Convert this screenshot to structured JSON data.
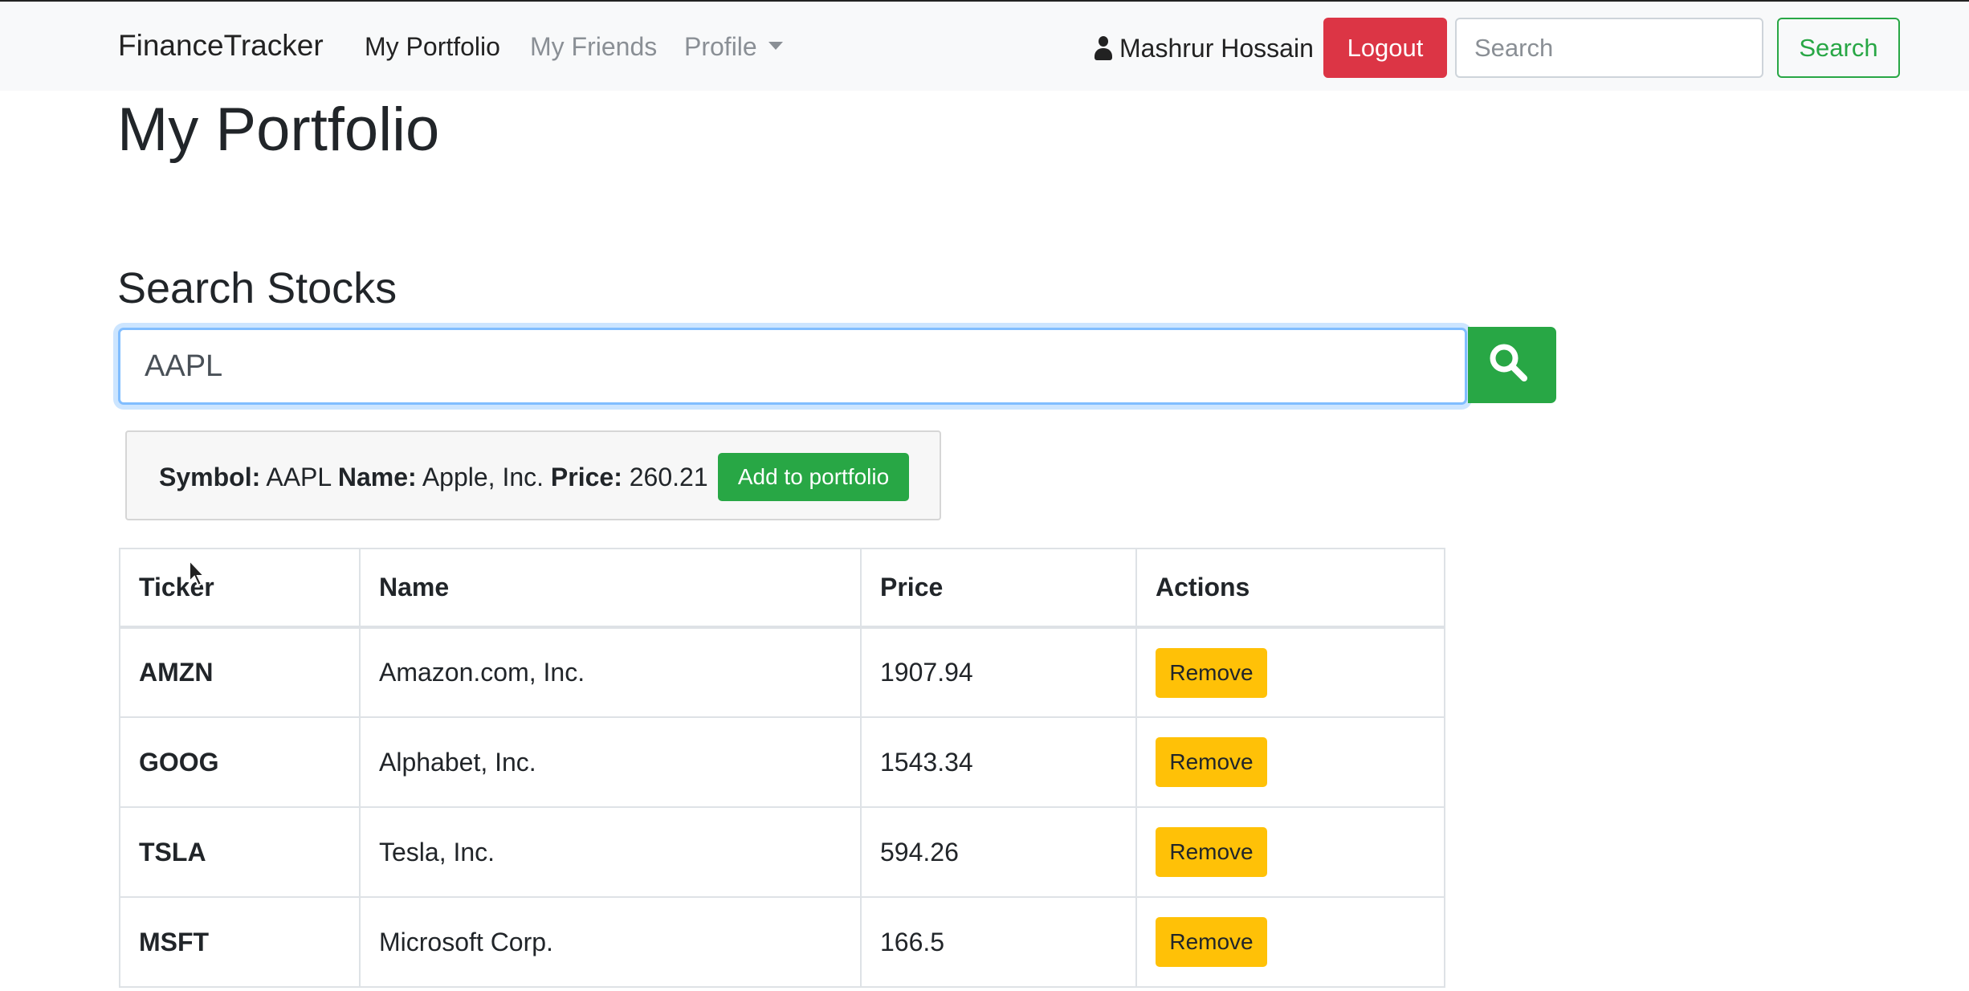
{
  "navbar": {
    "brand": "FinanceTracker",
    "links": [
      "My Portfolio",
      "My Friends",
      "Profile"
    ],
    "active_link": "My Portfolio",
    "user_name": "Mashrur Hossain",
    "logout_label": "Logout",
    "search_placeholder": "Search",
    "search_button_label": "Search"
  },
  "page": {
    "title": "My Portfolio",
    "search_section_title": "Search Stocks",
    "search_input_value": "AAPL"
  },
  "search_result": {
    "symbol_label": "Symbol:",
    "symbol": "AAPL",
    "name_label": "Name:",
    "name": "Apple, Inc.",
    "price_label": "Price:",
    "price": "260.21",
    "add_button_label": "Add to portfolio"
  },
  "table": {
    "columns": [
      "Ticker",
      "Name",
      "Price",
      "Actions"
    ],
    "rows": [
      {
        "ticker": "AMZN",
        "name": "Amazon.com, Inc.",
        "price": "1907.94",
        "action": "Remove"
      },
      {
        "ticker": "GOOG",
        "name": "Alphabet, Inc.",
        "price": "1543.34",
        "action": "Remove"
      },
      {
        "ticker": "TSLA",
        "name": "Tesla, Inc.",
        "price": "594.26",
        "action": "Remove"
      },
      {
        "ticker": "MSFT",
        "name": "Microsoft Corp.",
        "price": "166.5",
        "action": "Remove"
      }
    ]
  },
  "colors": {
    "danger": "#dc3545",
    "success": "#28a745",
    "warning": "#ffc107",
    "navbar_bg": "#f8f9fa"
  },
  "icons": {
    "user": "user-icon",
    "search": "magnifier-icon",
    "dropdown": "caret-down-icon"
  }
}
